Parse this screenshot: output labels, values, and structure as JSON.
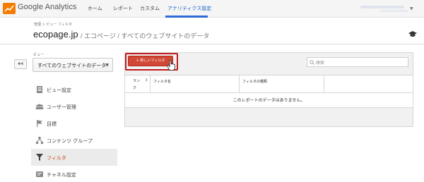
{
  "app": {
    "brand": "Google Analytics"
  },
  "nav": {
    "home": "ホーム",
    "reports": "レポート",
    "custom": "カスタム",
    "admin": "アナリティクス設定"
  },
  "header": {
    "breadcrumb": "管理 > ビュー フィルタ",
    "site": "ecopage.jp",
    "path": "/ エコページ / すべてのウェブサイトのデータ"
  },
  "sidebar": {
    "view_label": "ビュー",
    "view_selected": "すべてのウェブサイトのデータ",
    "back_label": "↤",
    "items": [
      {
        "label": "ビュー設定",
        "icon": "document-icon",
        "active": false
      },
      {
        "label": "ユーザー管理",
        "icon": "users-icon",
        "active": false
      },
      {
        "label": "目標",
        "icon": "flag-icon",
        "active": false
      },
      {
        "label": "コンテンツ グループ",
        "icon": "content-group-icon",
        "active": false
      },
      {
        "label": "フィルタ",
        "icon": "filter-icon",
        "active": true
      },
      {
        "label": "チャネル設定",
        "icon": "channel-icon",
        "active": false
      }
    ]
  },
  "main": {
    "new_filter_label": "+ 新しいフィルタ",
    "search_placeholder": "検索",
    "table": {
      "headers": {
        "rank_a": "ラン",
        "rank_b": "ク",
        "filter_name": "フィルタ名",
        "filter_type": "フィルタの種類"
      },
      "empty_message": "このレポートのデータはありません。"
    }
  },
  "colors": {
    "accent_blue": "#2c6bd6",
    "active_orange": "#c64b1b",
    "button_red": "#d14836",
    "highlight_frame": "#c0191b"
  }
}
